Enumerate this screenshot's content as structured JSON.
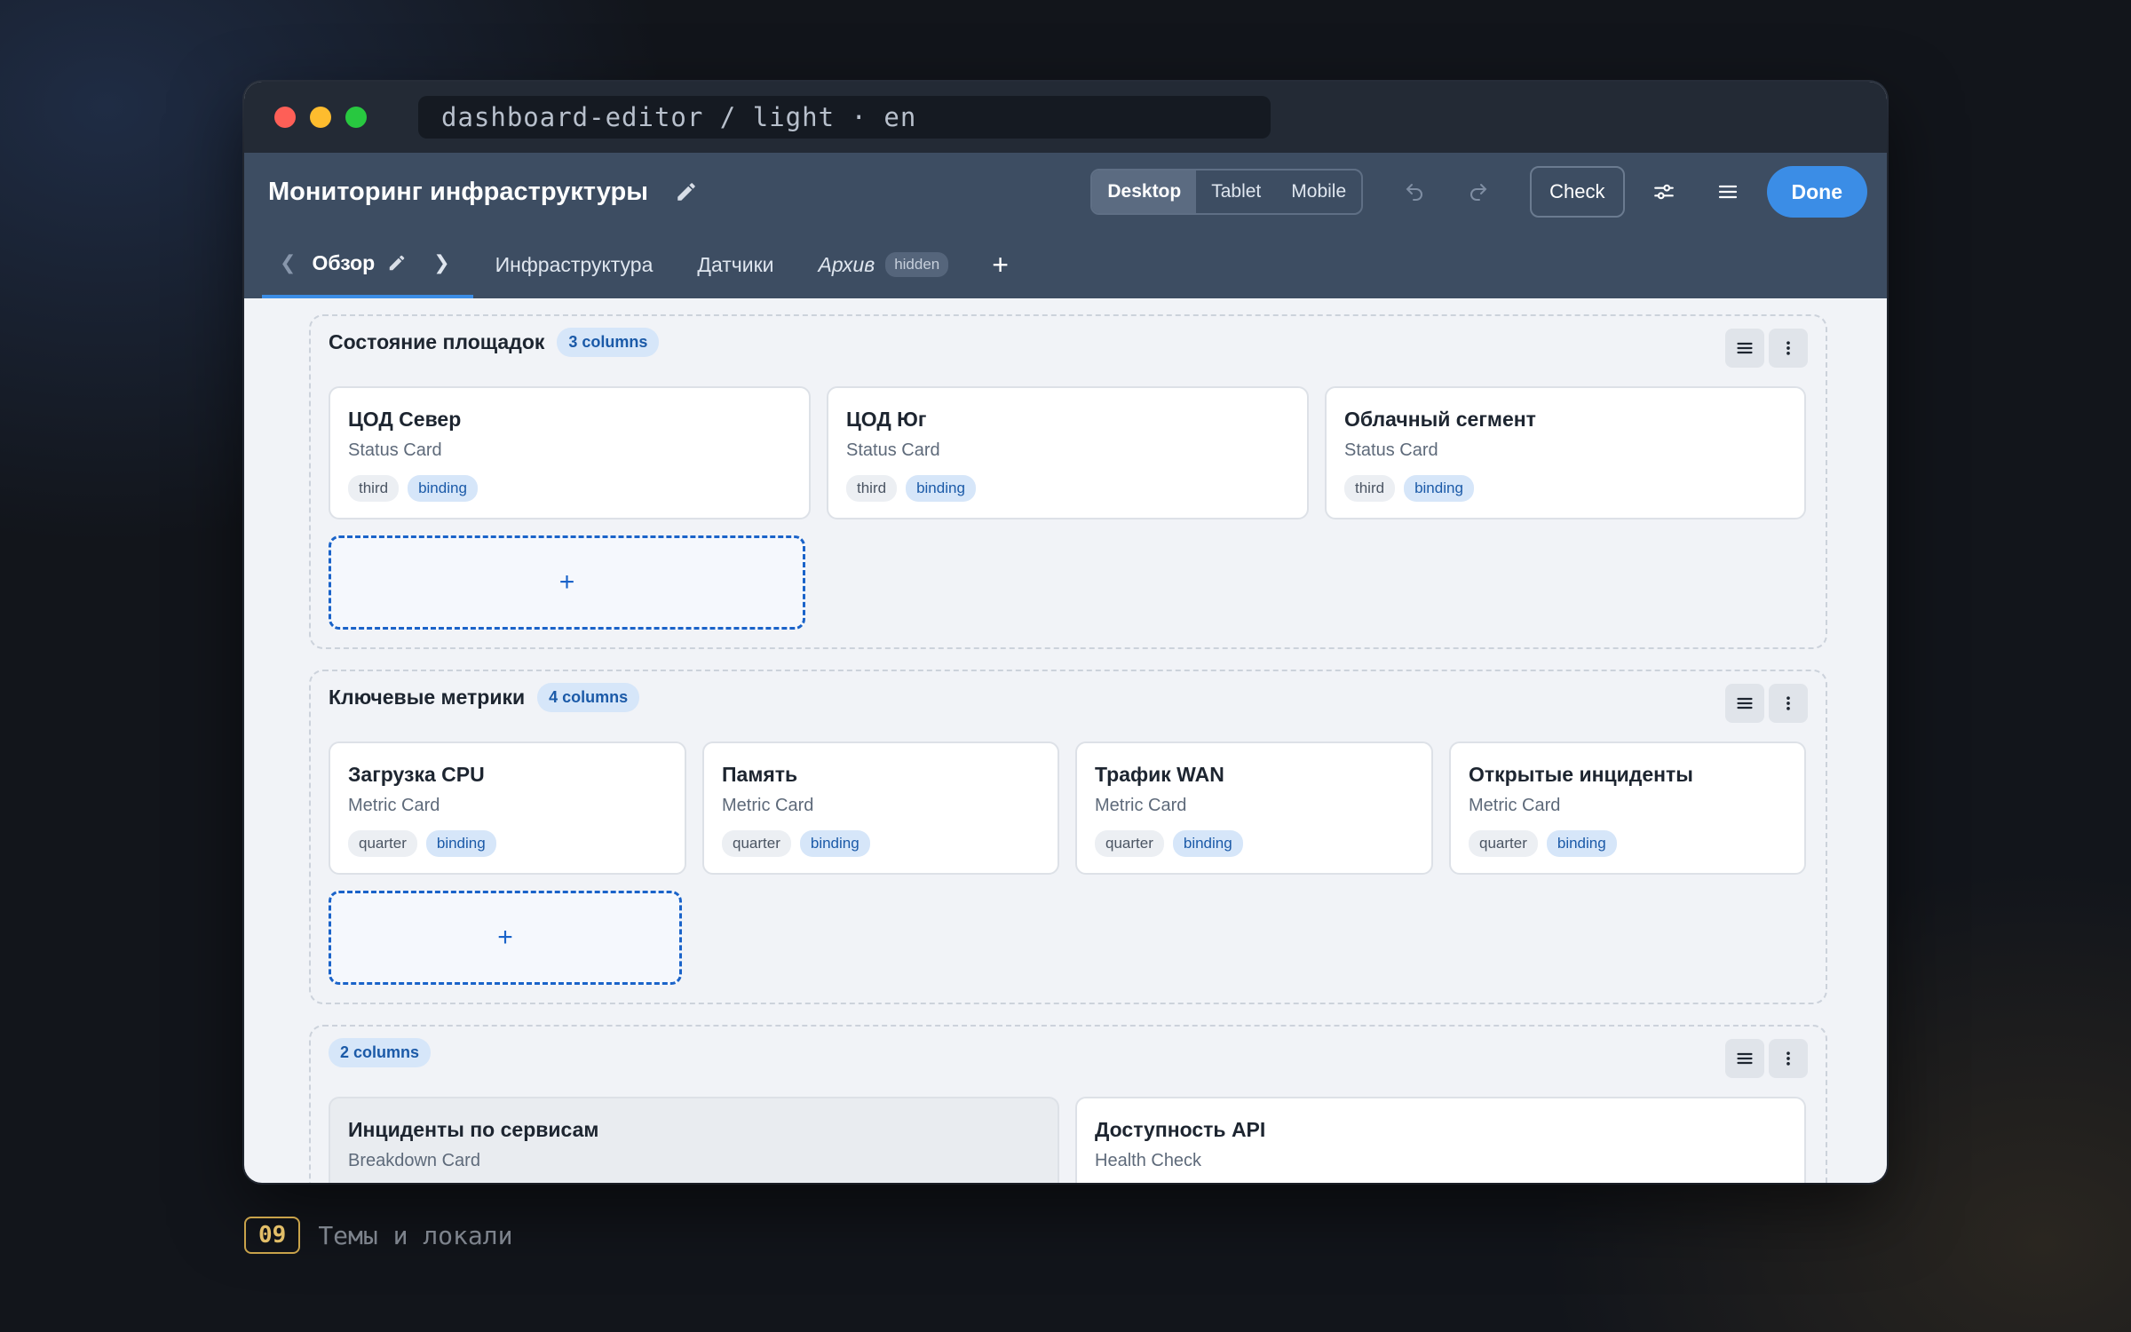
{
  "window": {
    "path": "dashboard-editor / light · en"
  },
  "header": {
    "title": "Мониторинг инфраструктуры",
    "viewports": [
      "Desktop",
      "Tablet",
      "Mobile"
    ],
    "active_viewport": "Desktop",
    "check_label": "Check",
    "done_label": "Done"
  },
  "tabs": {
    "active": "Обзор",
    "items": [
      "Инфраструктура",
      "Датчики"
    ],
    "hidden_tab": "Архив",
    "hidden_badge": "hidden",
    "add": "+"
  },
  "sections": [
    {
      "title": "Состояние площадок",
      "badge": "3 columns",
      "cards": [
        {
          "title": "ЦОД Север",
          "type": "Status Card",
          "size": "third",
          "binding": "binding"
        },
        {
          "title": "ЦОД Юг",
          "type": "Status Card",
          "size": "third",
          "binding": "binding"
        },
        {
          "title": "Облачный сегмент",
          "type": "Status Card",
          "size": "third",
          "binding": "binding"
        }
      ],
      "add": "+"
    },
    {
      "title": "Ключевые метрики",
      "badge": "4 columns",
      "cards": [
        {
          "title": "Загрузка CPU",
          "type": "Metric Card",
          "size": "quarter",
          "binding": "binding"
        },
        {
          "title": "Память",
          "type": "Metric Card",
          "size": "quarter",
          "binding": "binding"
        },
        {
          "title": "Трафик WAN",
          "type": "Metric Card",
          "size": "quarter",
          "binding": "binding"
        },
        {
          "title": "Открытые инциденты",
          "type": "Metric Card",
          "size": "quarter",
          "binding": "binding"
        }
      ],
      "add": "+"
    },
    {
      "title": "",
      "badge": "2 columns",
      "cards": [
        {
          "title": "Инциденты по сервисам",
          "type": "Breakdown Card"
        },
        {
          "title": "Доступность API",
          "type": "Health Check"
        }
      ]
    }
  ],
  "caption": {
    "number": "09",
    "text": "Темы и локали"
  },
  "colors": {
    "accent": "#3b8de6",
    "header": "#3d4d62",
    "titlebar": "#232a35"
  }
}
